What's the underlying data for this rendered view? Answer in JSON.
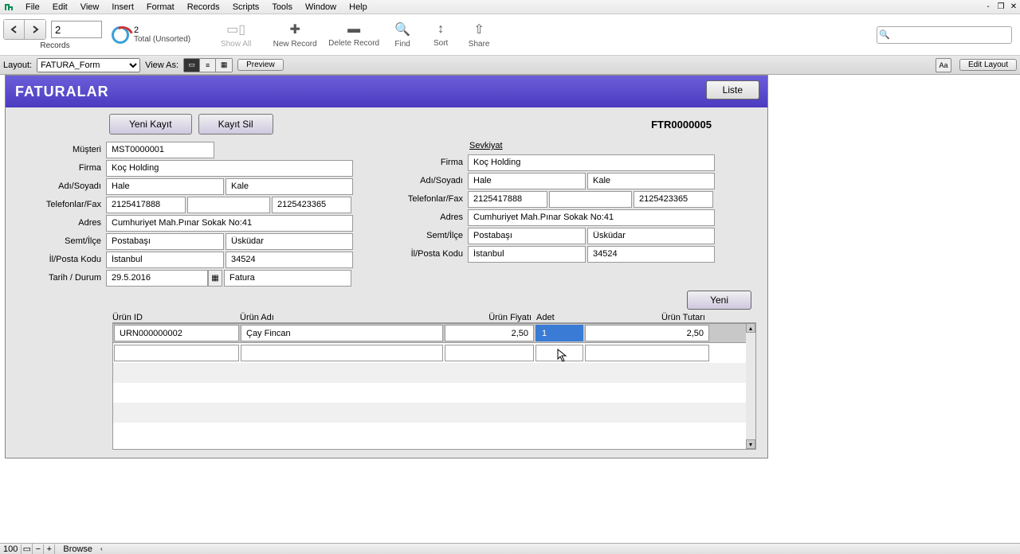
{
  "menu": {
    "items": [
      "File",
      "Edit",
      "View",
      "Insert",
      "Format",
      "Records",
      "Scripts",
      "Tools",
      "Window",
      "Help"
    ]
  },
  "toolbar": {
    "record_current": "2",
    "record_total": "2",
    "record_sort": "Total (Unsorted)",
    "records_label": "Records",
    "show_all": "Show All",
    "new_record": "New Record",
    "delete_record": "Delete Record",
    "find": "Find",
    "sort": "Sort",
    "share": "Share"
  },
  "layout_bar": {
    "layout_label": "Layout:",
    "layout_value": "FATURA_Form",
    "view_as_label": "View As:",
    "preview": "Preview",
    "edit_layout": "Edit Layout"
  },
  "form": {
    "title": "FATURALAR",
    "liste": "Liste",
    "yeni_kayit": "Yeni Kayıt",
    "kayit_sil": "Kayıt Sil",
    "doc_id": "FTR0000005",
    "labels": {
      "musteri": "Müşteri",
      "firma": "Firma",
      "adsoyad": "Adı/Soyadı",
      "telfax": "Telefonlar/Fax",
      "adres": "Adres",
      "semt": "Semt/İlçe",
      "ilposta": "İl/Posta Kodu",
      "tarih": "Tarih / Durum",
      "sevkiyat": "Sevkiyat"
    },
    "left": {
      "musteri": "MST0000001",
      "firma": "Koç Holding",
      "ad": "Hale",
      "soyad": "Kale",
      "tel1": "2125417888",
      "tel2": "",
      "fax": "2125423365",
      "adres": "Cumhuriyet Mah.Pınar Sokak No:41",
      "semt": "Postabaşı",
      "ilce": "Üsküdar",
      "il": "İstanbul",
      "posta": "34524",
      "tarih": "29.5.2016",
      "durum": "Fatura"
    },
    "right": {
      "firma": "Koç Holding",
      "ad": "Hale",
      "soyad": "Kale",
      "tel1": "2125417888",
      "tel2": "",
      "fax": "2125423365",
      "adres": "Cumhuriyet Mah.Pınar Sokak No:41",
      "semt": "Postabaşı",
      "ilce": "Üsküdar",
      "il": "İstanbul",
      "posta": "34524"
    },
    "yeni": "Yeni",
    "grid_headers": {
      "c1": "Ürün ID",
      "c2": "Ürün Adı",
      "c3": "Ürün Fiyatı",
      "c4": "Adet",
      "c5": "Ürün Tutarı"
    },
    "rows": [
      {
        "id": "URN000000002",
        "ad": "Çay Fincan",
        "fiyat": "2,50",
        "adet": "1",
        "tutar": "2,50"
      },
      {
        "id": "",
        "ad": "",
        "fiyat": "",
        "adet": "",
        "tutar": ""
      }
    ]
  },
  "status": {
    "zoom": "100",
    "mode": "Browse"
  }
}
